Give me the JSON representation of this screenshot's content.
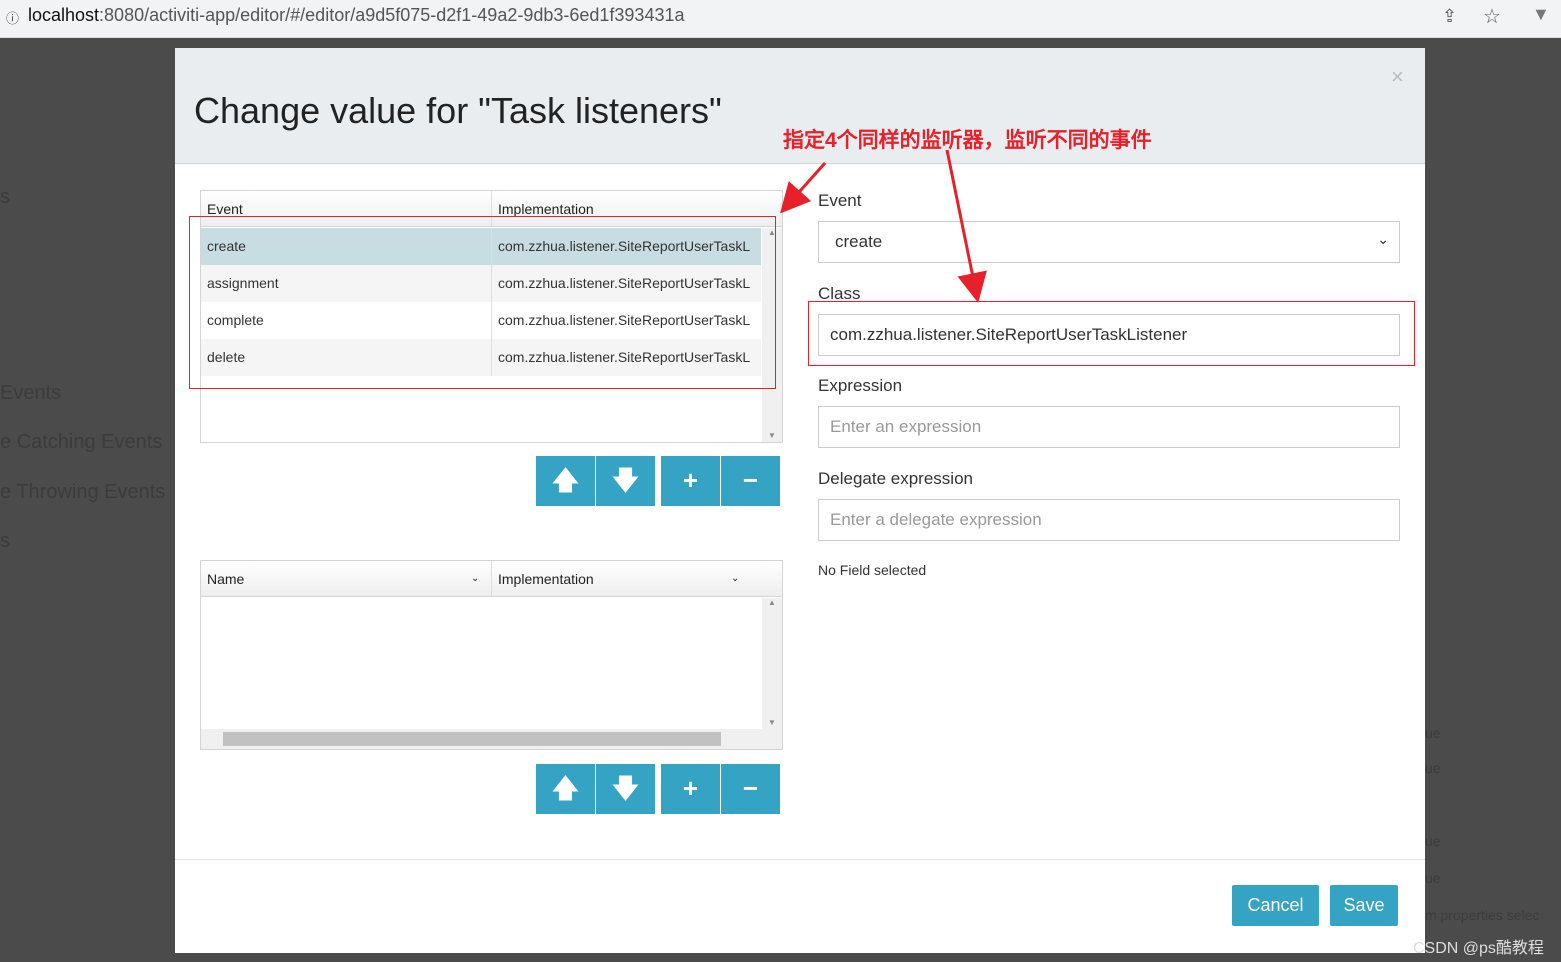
{
  "browser": {
    "url_host": "localhost",
    "url_rest": ":8080/activiti-app/editor/#/editor/a9d5f075-d2f1-49a2-9db3-6ed1f393431a",
    "share_icon": "share-icon",
    "star_icon": "star-icon"
  },
  "background": {
    "items": [
      "s",
      "Events",
      "e Catching Events",
      "e Throwing Events",
      "s"
    ],
    "right_items": [
      "ue",
      "ue",
      "ue",
      "ue",
      "m properties selec"
    ]
  },
  "modal": {
    "title": "Change value for \"Task listeners\"",
    "close": "×",
    "listeners_table": {
      "headers": [
        "Event",
        "Implementation"
      ],
      "rows": [
        {
          "event": "create",
          "implementation": "com.zzhua.listener.SiteReportUserTaskL",
          "selected": true
        },
        {
          "event": "assignment",
          "implementation": "com.zzhua.listener.SiteReportUserTaskL"
        },
        {
          "event": "complete",
          "implementation": "com.zzhua.listener.SiteReportUserTaskL"
        },
        {
          "event": "delete",
          "implementation": "com.zzhua.listener.SiteReportUserTaskL"
        }
      ]
    },
    "fields_table": {
      "headers": [
        "Name",
        "Implementation"
      ],
      "rows": []
    },
    "buttons": {
      "up": "🡅",
      "down": "🡇",
      "add": "+",
      "remove": "−"
    },
    "form": {
      "event_label": "Event",
      "event_value": "create",
      "class_label": "Class",
      "class_value": "com.zzhua.listener.SiteReportUserTaskListener",
      "expression_label": "Expression",
      "expression_placeholder": "Enter an expression",
      "delegate_label": "Delegate expression",
      "delegate_placeholder": "Enter a delegate expression",
      "no_field": "No Field selected"
    },
    "footer": {
      "cancel": "Cancel",
      "save": "Save"
    }
  },
  "annotation": {
    "text": "指定4个同样的监听器，监听不同的事件",
    "color": "#e8202a"
  },
  "watermark": "CSDN @ps酷教程",
  "colors": {
    "accent": "#35a3c4",
    "selected_row": "#c8dde2"
  }
}
